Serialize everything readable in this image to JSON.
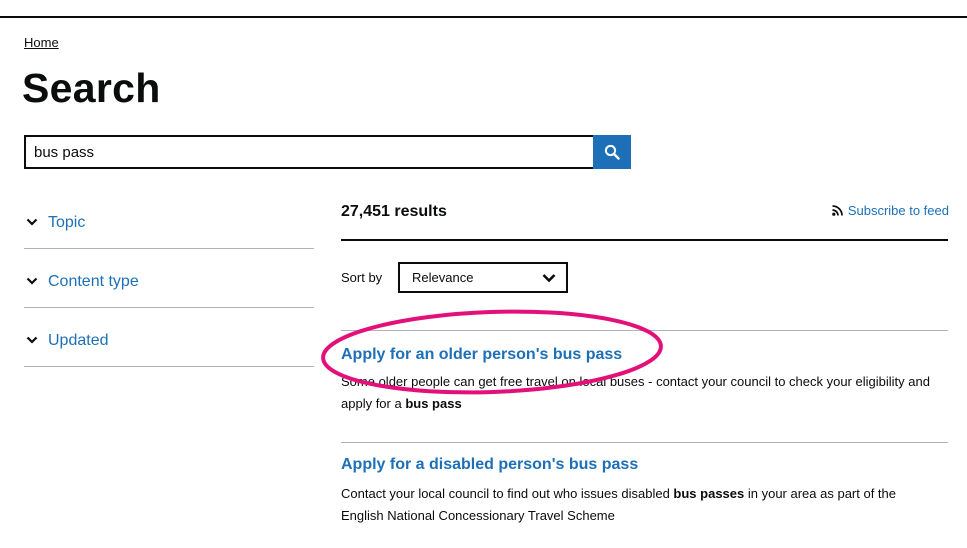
{
  "breadcrumb": {
    "home": "Home"
  },
  "page": {
    "title": "Search"
  },
  "search": {
    "value": "bus pass",
    "placeholder": ""
  },
  "filters": [
    {
      "label": "Topic"
    },
    {
      "label": "Content type"
    },
    {
      "label": "Updated"
    }
  ],
  "results_header": {
    "count": "27,451 results",
    "subscribe_label": "Subscribe to feed",
    "sort_label": "Sort by",
    "sort_value": "Relevance"
  },
  "results": [
    {
      "title": "Apply for an older person's bus pass",
      "desc_before": "Some older people can get free travel on local buses - contact your council to check your eligibility and apply for a ",
      "desc_bold": "bus pass",
      "desc_after": ""
    },
    {
      "title": "Apply for a disabled person's bus pass",
      "desc_before": "Contact your local council to find out who issues disabled ",
      "desc_bold": "bus passes",
      "desc_after": " in your area as part of the English National Concessionary Travel Scheme"
    }
  ],
  "colors": {
    "link": "#1d70b8",
    "text": "#0b0c0c",
    "highlight": "#e3107a",
    "border": "#b1b4b6"
  },
  "icons": {
    "search": "search-icon",
    "filter_toggle": "chevron-down-icon",
    "feed": "rss-icon",
    "select": "chevron-down-icon"
  }
}
